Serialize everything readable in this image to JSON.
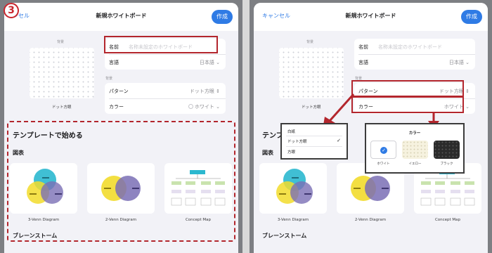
{
  "step_number": "3",
  "dialog": {
    "cancel_left": "ンセル",
    "cancel_right": "キャンセル",
    "title": "新規ホワイトボード",
    "create_label": "作成"
  },
  "background_section": {
    "label": "背景",
    "pattern_caption": "ドット方眼"
  },
  "form": {
    "name_label": "名前",
    "name_placeholder": "名称未設定のホワイトボード",
    "language_label": "言語",
    "language_value": "日本語",
    "background_label": "背景",
    "pattern_label": "パターン",
    "pattern_value": "ドット方眼",
    "color_label": "カラー",
    "color_value": "ホワイト"
  },
  "templates": {
    "heading": "テンプレートで始める",
    "category": "図表",
    "items": [
      {
        "name": "3-Venn Diagram"
      },
      {
        "name": "2-Venn Diagram"
      },
      {
        "name": "Concept Map"
      }
    ],
    "next_category": "ブレーンストーム"
  },
  "pattern_menu": {
    "options": [
      "白紙",
      "ドット方眼",
      "方眼"
    ],
    "selected": "ドット方眼"
  },
  "color_menu": {
    "title": "カラー",
    "options": [
      {
        "name": "ホワイト",
        "color": "#ffffff",
        "selected": true
      },
      {
        "name": "イエロー",
        "color": "#f6f2df",
        "selected": false
      },
      {
        "name": "ブラック",
        "color": "#2b2b2b",
        "selected": false
      }
    ]
  },
  "colors": {
    "accent": "#2f7be5",
    "highlight": "#b3262d",
    "venn_cyan": "#2bb8cf",
    "venn_yellow": "#f2dc2c",
    "venn_purple": "#7a6fb5"
  }
}
